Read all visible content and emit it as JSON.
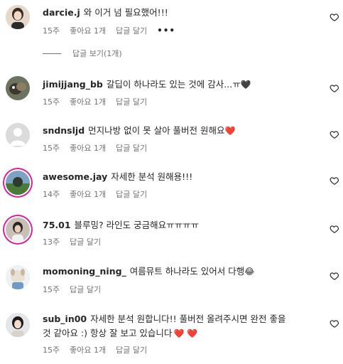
{
  "comments": [
    {
      "username": "darcie.j",
      "text": "와 이거 넘 필요했어!!!",
      "emoji": "",
      "time": "15주",
      "likes": "좋아요 1개",
      "reply": "답글 달기",
      "more": "•••"
    },
    {
      "username": "jimijjang_bb",
      "text": "갈딥이 하나라도 있는 것에 감사...ㅠ",
      "emoji": "🖤",
      "time": "15주",
      "likes": "좋아요 1개",
      "reply": "답글 달기"
    },
    {
      "username": "sndnsljd",
      "text": "먼지나방 없이 못 살아 풀버전 원해요",
      "emoji": "❤️",
      "time": "15주",
      "likes": "좋아요 1개",
      "reply": "답글 달기"
    },
    {
      "username": "awesome.jay",
      "text": "자세한 분석 원해용!!!",
      "emoji": "",
      "time": "14주",
      "likes": "좋아요 1개",
      "reply": "답글 달기"
    },
    {
      "username": "75.01",
      "text": "블루밍? 라인도 궁금해요ㅠㅠㅠㅠ",
      "emoji": "",
      "time": "13주",
      "likes": "",
      "reply": "답글 달기"
    },
    {
      "username": "momoning_ning_",
      "text": "여름뮤트 하나라도 있어서 다행",
      "emoji": "😂",
      "time": "15주",
      "likes": "",
      "reply": "답글 달기"
    },
    {
      "username": "sub_in00",
      "text": "자세한 분석 원합니다!! 풀버전 올려주시면 완전 좋을",
      "text2": "것 같아요 :) 항상 잘 보고 있습니다",
      "emoji": "❤️ ❤️",
      "time": "15주",
      "likes": "좋아요 1개",
      "reply": "답글 달기"
    }
  ],
  "view_replies": "답글 보기(1개)",
  "icons": {
    "heart": "heart-outline-icon"
  },
  "colors": {
    "text": "#262626",
    "secondary": "#737373",
    "story_ring": "#d6249f"
  }
}
